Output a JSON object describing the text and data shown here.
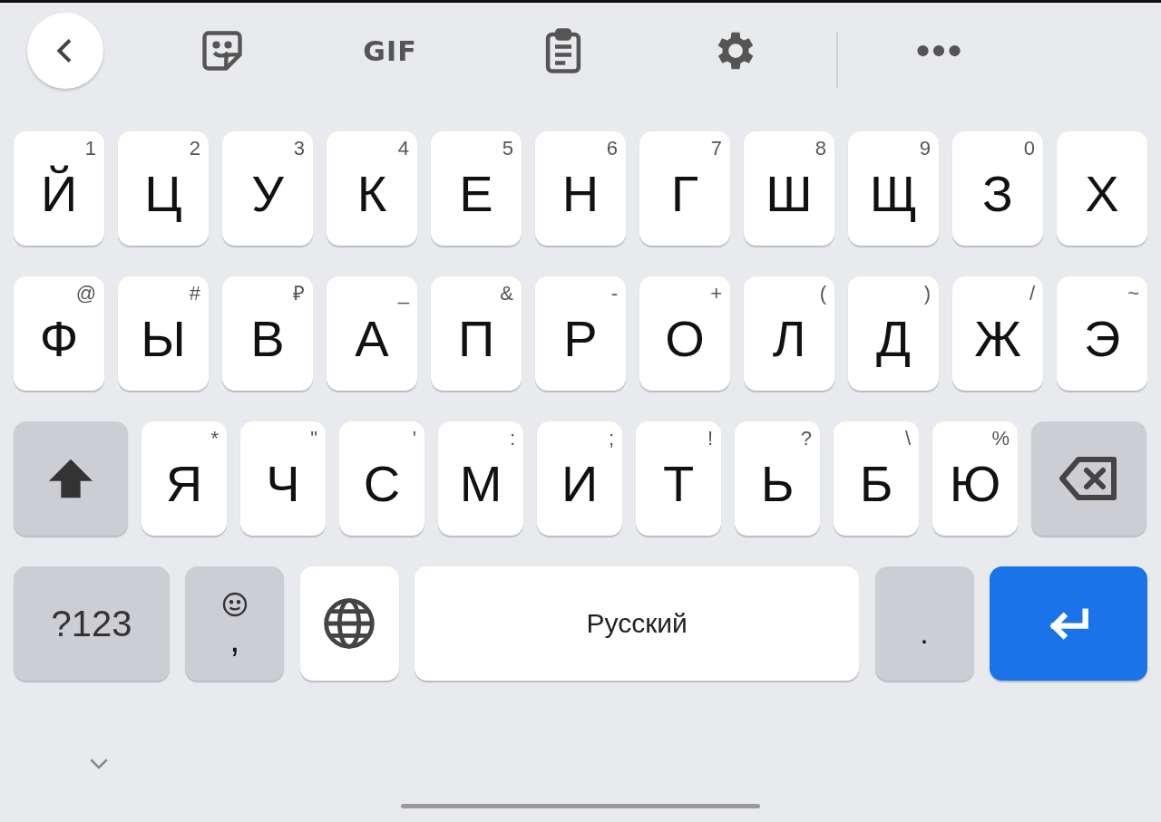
{
  "toolbar": {
    "gif_label": "GIF"
  },
  "rows": [
    {
      "keys": [
        {
          "kind": "letter",
          "label": "Й",
          "hint": "1"
        },
        {
          "kind": "letter",
          "label": "Ц",
          "hint": "2"
        },
        {
          "kind": "letter",
          "label": "У",
          "hint": "3"
        },
        {
          "kind": "letter",
          "label": "К",
          "hint": "4"
        },
        {
          "kind": "letter",
          "label": "Е",
          "hint": "5"
        },
        {
          "kind": "letter",
          "label": "Н",
          "hint": "6"
        },
        {
          "kind": "letter",
          "label": "Г",
          "hint": "7"
        },
        {
          "kind": "letter",
          "label": "Ш",
          "hint": "8"
        },
        {
          "kind": "letter",
          "label": "Щ",
          "hint": "9"
        },
        {
          "kind": "letter",
          "label": "З",
          "hint": "0"
        },
        {
          "kind": "letter",
          "label": "Х"
        }
      ]
    },
    {
      "keys": [
        {
          "kind": "letter",
          "label": "Ф",
          "hint": "@"
        },
        {
          "kind": "letter",
          "label": "Ы",
          "hint": "#"
        },
        {
          "kind": "letter",
          "label": "В",
          "hint": "₽"
        },
        {
          "kind": "letter",
          "label": "А",
          "hint": "_"
        },
        {
          "kind": "letter",
          "label": "П",
          "hint": "&"
        },
        {
          "kind": "letter",
          "label": "Р",
          "hint": "-"
        },
        {
          "kind": "letter",
          "label": "О",
          "hint": "+"
        },
        {
          "kind": "letter",
          "label": "Л",
          "hint": "("
        },
        {
          "kind": "letter",
          "label": "Д",
          "hint": ")"
        },
        {
          "kind": "letter",
          "label": "Ж",
          "hint": "/"
        },
        {
          "kind": "letter",
          "label": "Э",
          "hint": "~"
        }
      ]
    },
    {
      "keys": [
        {
          "kind": "shift"
        },
        {
          "kind": "letter",
          "label": "Я",
          "hint": "*"
        },
        {
          "kind": "letter",
          "label": "Ч",
          "hint": "\""
        },
        {
          "kind": "letter",
          "label": "С",
          "hint": "'"
        },
        {
          "kind": "letter",
          "label": "М",
          "hint": ":"
        },
        {
          "kind": "letter",
          "label": "И",
          "hint": ";"
        },
        {
          "kind": "letter",
          "label": "Т",
          "hint": "!"
        },
        {
          "kind": "letter",
          "label": "Ь",
          "hint": "?"
        },
        {
          "kind": "letter",
          "label": "Б",
          "hint": "\\"
        },
        {
          "kind": "letter",
          "label": "Ю",
          "hint": "%"
        },
        {
          "kind": "backspace"
        }
      ]
    },
    {
      "keys": [
        {
          "kind": "symbols",
          "label": "?123"
        },
        {
          "kind": "comma",
          "label": ","
        },
        {
          "kind": "globe"
        },
        {
          "kind": "space",
          "label": "Русский"
        },
        {
          "kind": "period",
          "label": "."
        },
        {
          "kind": "enter"
        }
      ]
    }
  ]
}
